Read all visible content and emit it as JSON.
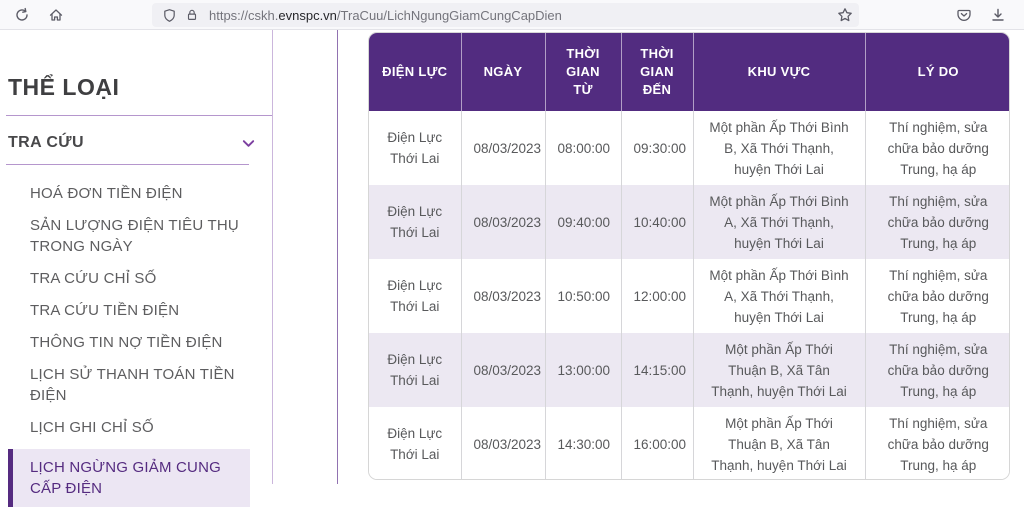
{
  "browser": {
    "url": {
      "prefix": "https://",
      "subdomain": "cskh.",
      "domain": "evnspc.vn",
      "path": "/TraCuu/LichNgungGiamCungCapDien"
    }
  },
  "sidebar": {
    "title": "THỂ LOẠI",
    "section": "TRA CỨU",
    "items": [
      {
        "label": "HOÁ ĐƠN TIỀN ĐIỆN",
        "active": false
      },
      {
        "label": "SẢN LƯỢNG ĐIỆN TIÊU THỤ TRONG NGÀY",
        "active": false
      },
      {
        "label": "TRA CỨU CHỈ SỐ",
        "active": false
      },
      {
        "label": "TRA CỨU TIỀN ĐIỆN",
        "active": false
      },
      {
        "label": "THÔNG TIN NỢ TIỀN ĐIỆN",
        "active": false
      },
      {
        "label": "LỊCH SỬ THANH TOÁN TIỀN ĐIỆN",
        "active": false
      },
      {
        "label": "LỊCH GHI CHỈ SỐ",
        "active": false
      },
      {
        "label": "LỊCH NGỪNG GIẢM CUNG CẤP ĐIỆN",
        "active": true
      }
    ]
  },
  "table": {
    "headers": [
      "ĐIỆN LỰC",
      "NGÀY",
      "THỜI GIAN TỪ",
      "THỜI GIAN ĐẾN",
      "KHU VỰC",
      "LÝ DO"
    ],
    "rows": [
      [
        "Điện Lực Thới Lai",
        "08/03/2023",
        "08:00:00",
        "09:30:00",
        "Một phần Ấp Thới Bình B, Xã Thới Thạnh, huyện Thới Lai",
        "Thí nghiệm, sửa chữa bảo dưỡng Trung, hạ áp"
      ],
      [
        "Điện Lực Thới Lai",
        "08/03/2023",
        "09:40:00",
        "10:40:00",
        "Một phần Ấp Thới Bình A, Xã Thới Thạnh, huyện Thới Lai",
        "Thí nghiệm, sửa chữa bảo dưỡng Trung, hạ áp"
      ],
      [
        "Điện Lực Thới Lai",
        "08/03/2023",
        "10:50:00",
        "12:00:00",
        "Một phần Ấp Thới Bình A, Xã Thới Thạnh, huyện Thới Lai",
        "Thí nghiệm, sửa chữa bảo dưỡng Trung, hạ áp"
      ],
      [
        "Điện Lực Thới Lai",
        "08/03/2023",
        "13:00:00",
        "14:15:00",
        "Một phần Ấp Thới Thuận B, Xã Tân Thạnh, huyện Thới Lai",
        "Thí nghiệm, sửa chữa bảo dưỡng Trung, hạ áp"
      ],
      [
        "Điện Lực Thới Lai",
        "08/03/2023",
        "14:30:00",
        "16:00:00",
        "Một phần Ấp Thới Thuận B, Xã Tân Thạnh, huyện Thới Lai",
        "Thí nghiệm, sửa chữa bảo dưỡng Trung, hạ áp"
      ]
    ]
  },
  "colors": {
    "brand_purple": "#522c80",
    "row_stripe": "#ece8f2",
    "active_item_bg": "#ece6f3",
    "divider_purple": "#b596cd"
  }
}
